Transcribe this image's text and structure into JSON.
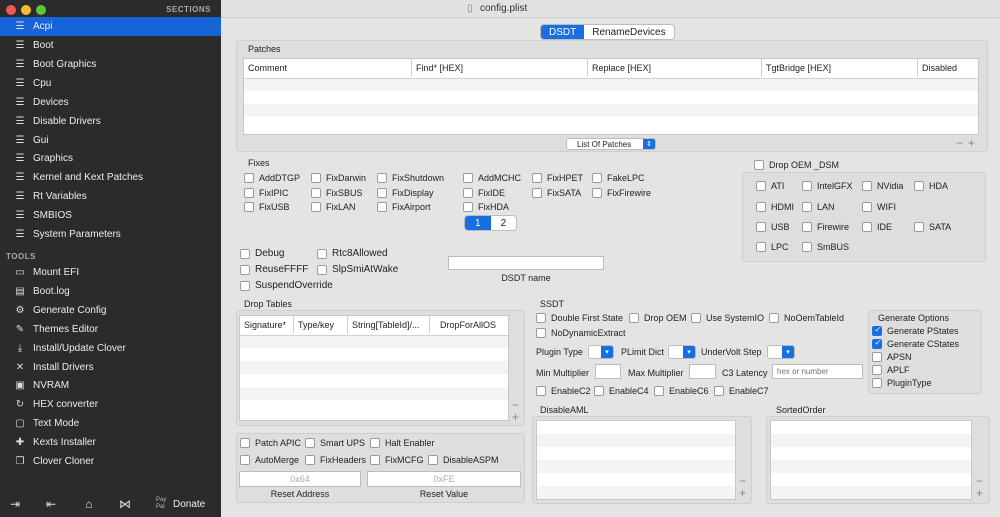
{
  "window": {
    "title": "config.plist"
  },
  "sidebar": {
    "sections_header": "SECTIONS",
    "items": [
      "Acpi",
      "Boot",
      "Boot Graphics",
      "Cpu",
      "Devices",
      "Disable Drivers",
      "Gui",
      "Graphics",
      "Kernel and Kext Patches",
      "Rt Variables",
      "SMBIOS",
      "System Parameters"
    ],
    "tools_header": "TOOLS",
    "tools": [
      "Mount EFI",
      "Boot.log",
      "Generate Config",
      "Themes Editor",
      "Install/Update Clover",
      "Install Drivers",
      "NVRAM",
      "HEX converter",
      "Text Mode",
      "Kexts Installer",
      "Clover Cloner"
    ],
    "donate_label": "Donate",
    "paypal_label": "Pay Pal"
  },
  "tabs": {
    "dsdt": "DSDT",
    "rename": "RenameDevices"
  },
  "patches": {
    "label": "Patches",
    "columns": [
      "Comment",
      "Find* [HEX]",
      "Replace [HEX]",
      "TgtBridge [HEX]",
      "Disabled"
    ],
    "list_button": "List Of Patches"
  },
  "fixes": {
    "label": "Fixes",
    "items": [
      "AddDTGP",
      "FixDarwin",
      "FixShutdown",
      "AddMCHC",
      "FixHPET",
      "FakeLPC",
      "FixIPIC",
      "FixSBUS",
      "FixDisplay",
      "FixIDE",
      "FixSATA",
      "FixFirewire",
      "FixUSB",
      "FixLAN",
      "FixAirport",
      "FixHDA"
    ],
    "pages": [
      "1",
      "2"
    ]
  },
  "drop_oem": {
    "label": "Drop OEM _DSM",
    "items": [
      "ATI",
      "IntelGFX",
      "NVidia",
      "HDA",
      "HDMI",
      "LAN",
      "WIFI",
      "USB",
      "Firewire",
      "IDE",
      "SATA",
      "LPC",
      "SmBUS"
    ]
  },
  "options": {
    "items": [
      "Debug",
      "Rtc8Allowed",
      "ReuseFFFF",
      "SlpSmiAtWake",
      "SuspendOverride"
    ]
  },
  "dsdt_name": {
    "label": "DSDT name",
    "value": ""
  },
  "drop_tables": {
    "label": "Drop Tables",
    "columns": [
      "Signature*",
      "Type/key",
      "String[TableId]/...",
      "DropForAllOS"
    ]
  },
  "ssdt": {
    "label": "SSDT",
    "checks": [
      "Double First State",
      "Drop OEM",
      "Use SystemIO",
      "NoOemTableId",
      "NoDynamicExtract"
    ],
    "plugin_type": "Plugin Type",
    "plimit_dict": "PLimit Dict",
    "undervolt_step": "UnderVolt Step",
    "min_multiplier": "Min Multiplier",
    "max_multiplier": "Max Multiplier",
    "c3_latency": "C3 Latency",
    "c3_placeholder": "hex or number",
    "enable_c": [
      "EnableC2",
      "EnableC4",
      "EnableC6",
      "EnableC7"
    ]
  },
  "generate_options": {
    "label": "Generate Options",
    "items": [
      "Generate PStates",
      "Generate CStates",
      "APSN",
      "APLF",
      "PluginType"
    ],
    "checked": [
      true,
      true,
      false,
      false,
      false
    ]
  },
  "disable_aml": {
    "label": "DisableAML"
  },
  "sorted_order": {
    "label": "SortedOrder"
  },
  "misc": {
    "checks": [
      "Patch APIC",
      "Smart UPS",
      "Halt Enabler",
      "AutoMerge",
      "FixHeaders",
      "FixMCFG",
      "DisableASPM"
    ],
    "reset_address_value": "0x64",
    "reset_address_label": "Reset Address",
    "reset_value_value": "0xFE",
    "reset_value_label": "Reset Value"
  },
  "colors": {
    "accent": "#1a6fe0",
    "sidebar_bg": "#2b2b2c"
  }
}
